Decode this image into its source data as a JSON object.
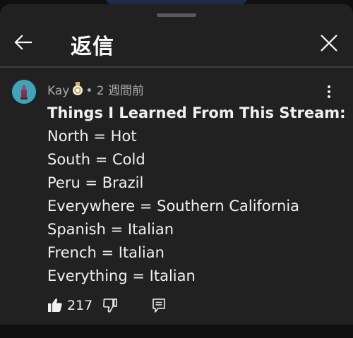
{
  "header": {
    "title": "返信"
  },
  "comment": {
    "author": "Kay",
    "separator": "•",
    "timestamp": "2 週間前",
    "lines": [
      "Things I Learned From This Stream:",
      "North = Hot",
      "South = Cold",
      "Peru = Brazil",
      "Everywhere = Southern California",
      "Spanish = Italian",
      "French = Italian",
      "Everything = Italian"
    ],
    "like_count": "217"
  },
  "icons": {
    "back": "arrow-left-icon",
    "close": "close-icon",
    "more": "more-vert-icon",
    "like": "thumb-up-icon",
    "dislike": "thumb-down-icon",
    "reply": "reply-icon",
    "badge": "member-badge-icon"
  },
  "colors": {
    "sheet_bg": "#212121",
    "page_bg": "#0f0f0f",
    "text_primary": "#f1f1f1",
    "text_secondary": "#aaaaaa",
    "avatar_bg": "#3aa6b8"
  }
}
